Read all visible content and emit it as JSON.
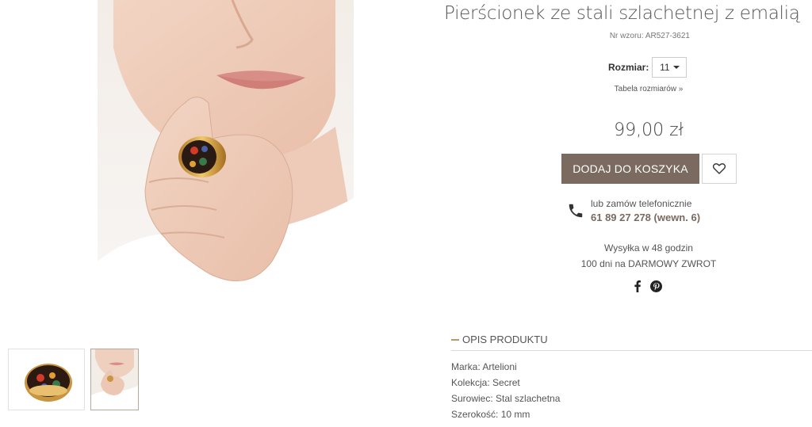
{
  "product": {
    "title": "Pierścionek ze stali szlachetnej z emalią",
    "sku": "Nr wzoru: AR527-3621",
    "size_label": "Rozmiar:",
    "size_selected": "11",
    "size_table_link": "Tabela rozmiarów »",
    "price": "99,00 zł"
  },
  "actions": {
    "add_to_cart": "DODAJ DO KOSZYKA",
    "wishlist_icon": "heart-icon"
  },
  "contact": {
    "label": "lub zamów telefonicznie",
    "phone": "61 89 27 278 (wewn. 6)"
  },
  "shipping": {
    "line1": "Wysyłka w 48 godzin",
    "line2": "100 dni na DARMOWY ZWROT"
  },
  "social": [
    "facebook-icon",
    "pinterest-icon"
  ],
  "description": {
    "header": "OPIS PRODUKTU",
    "specs": [
      "Marka: Artelioni",
      "Kolekcja: Secret",
      "Surowiec: Stal szlachetna",
      "Szerokość: 10 mm"
    ]
  },
  "colors": {
    "accent": "#7a6a5f",
    "accent_link": "#7a6a5f",
    "dash": "#b99a6e"
  }
}
